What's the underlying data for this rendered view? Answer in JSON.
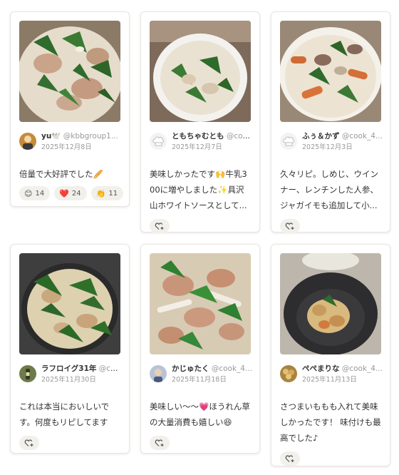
{
  "accent_colors": {
    "card_border": "#e8e6e0",
    "chip_bg": "#f2f0eb",
    "muted_text": "#999999"
  },
  "reports": [
    {
      "author": {
        "name": "yu🕊️",
        "handle": "@kbbgroup1...",
        "avatar_icon": "avatar-photo-icon"
      },
      "date": "2025年12月8日",
      "comment": "倍量で大好評でした🥖",
      "reactions": [
        {
          "emoji": "😊",
          "count": "14",
          "icon": "smile-icon"
        },
        {
          "emoji": "❤️",
          "count": "24",
          "icon": "heart-icon"
        },
        {
          "emoji": "👏",
          "count": "11",
          "icon": "clap-icon"
        }
      ]
    },
    {
      "author": {
        "name": "ともちゃむとも",
        "handle": "@coo...",
        "avatar_icon": "chef-hat-icon"
      },
      "date": "2025年12月7日",
      "comment": "美味しかったです🙌牛乳300に増やしました✨具沢山ホワイトソースとして...",
      "add_reaction_icon": "add-reaction-heart-icon"
    },
    {
      "author": {
        "name": "ふぅ＆かず",
        "handle": "@cook_4...",
        "avatar_icon": "chef-hat-icon"
      },
      "date": "2025年12月3日",
      "comment": "久々リピ。しめじ、ウインナー、レンチンした人参、ジャガイモも追加して小...",
      "add_reaction_icon": "add-reaction-heart-icon"
    },
    {
      "author": {
        "name": "ラフロイグ31年",
        "handle": "@co...",
        "avatar_icon": "avatar-photo-icon"
      },
      "date": "2025年11月30日",
      "comment": "これは本当においしいです。何度もリピしてます",
      "add_reaction_icon": "add-reaction-heart-icon"
    },
    {
      "author": {
        "name": "かじゅたく",
        "handle": "@cook_4...",
        "avatar_icon": "avatar-photo-icon"
      },
      "date": "2025年11月18日",
      "comment": "美味しい〜〜💗ほうれん草の大量消費も嬉しい😆",
      "add_reaction_icon": "add-reaction-heart-icon"
    },
    {
      "author": {
        "name": "ぺぺまりな",
        "handle": "@cook_4...",
        "avatar_icon": "avatar-photo-icon"
      },
      "date": "2025年11月13日",
      "comment": "さつまいももも入れて美味しかったです！ 味付けも最高でした♪",
      "add_reaction_icon": "add-reaction-heart-icon"
    }
  ]
}
